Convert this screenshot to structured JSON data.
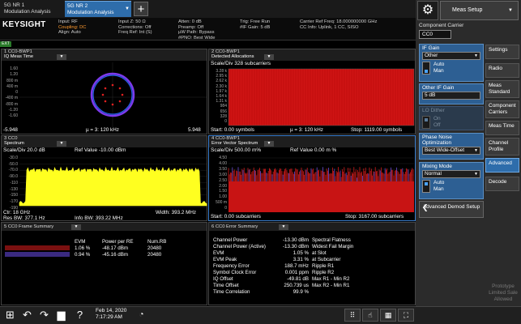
{
  "tabs": [
    {
      "line1": "5G NR 1",
      "line2": "Modulation Analysis",
      "active": false
    },
    {
      "line1": "5G NR 2",
      "line2": "Modulation Analysis",
      "active": true
    }
  ],
  "info": {
    "logo": "KEYSIGHT",
    "col1": [
      "Input: RF",
      "Coupling: DC",
      "Align: Auto"
    ],
    "col2": [
      "Input Z: 50 Ω",
      "Corrections: Off",
      "Freq Ref: Int (S)"
    ],
    "col3": [
      "Atten: 0 dB",
      "Preamp: Off",
      "µW Path: Bypass",
      "#PNO: Best Wide"
    ],
    "col4": [
      "Trig: Free Run",
      "#IF Gain: 5 dB"
    ],
    "col5": [
      "Carrier Ref Freq: 18.000000000 GHz",
      "CC Info: Uplink, 1 CC, SISO"
    ],
    "badge": "EXT"
  },
  "right": {
    "meas_setup": "Meas Setup",
    "component_carrier_label": "Component Carrier",
    "component_carrier_value": "CC0",
    "if_gain_title": "IF Gain",
    "if_gain_value": "Other",
    "if_gain_auto": "Auto",
    "if_gain_man": "Man",
    "other_if_gain_title": "Other IF Gain",
    "other_if_gain_value": "5 dB",
    "lo_dither_title": "LO Dither",
    "lo_dither_on": "On",
    "lo_dither_off": "Off",
    "phase_noise_title": "Phase Noise Optimization",
    "phase_noise_value": "Best Wide-Offset",
    "mixing_mode_title": "Mixing Mode",
    "mixing_mode_value": "Normal",
    "mixing_auto": "Auto",
    "mixing_man": "Man",
    "advanced_demod": "Advanced Demod Setup",
    "side_tabs": [
      "Settings",
      "Radio",
      "Meas Standard",
      "Component Carriers",
      "Meas Time",
      "Channel Profile",
      "Advanced",
      "Decode"
    ],
    "prototype": "Prototype Limited Sale Allowed"
  },
  "windows": {
    "w1": {
      "t1": "1 CC0-BWP1",
      "t2": "IQ Meas Time",
      "foot_left": "-5.948",
      "foot_mid": "µ = 3: 120 kHz",
      "foot_right": "5.948",
      "yticks": [
        "1.60",
        "1.20",
        "800 m",
        "400 m",
        "0",
        "-400 m",
        "-800 m",
        "-1.20",
        "-1.60"
      ]
    },
    "w2": {
      "t1": "2 CC0-BWP1",
      "t2": "Detected Allocations",
      "sub": "Scale/Div 328 subcarriers",
      "foot_left": "Start: 0.00 symbols",
      "foot_mid": "µ = 3: 120 kHz",
      "foot_right": "Stop: 1119.00 symbols",
      "yticks": [
        "3.28 k",
        "2.95 k",
        "2.62 k",
        "2.30 k",
        "1.97 k",
        "1.64 k",
        "1.31 k",
        "984",
        "656",
        "328",
        "0"
      ]
    },
    "w3": {
      "t1": "3 CC0",
      "t2": "Spectrum",
      "sub_left": "Scale/Div 20.0 dB",
      "sub_right": "Ref Value -10.00 dBm",
      "foot_left": "Ctr: 18 GHz",
      "foot_left2": "Res BW: 377.1 Hz",
      "foot_mid": "Info BW: 393.22 MHz",
      "foot_right": "Width: 393.2 MHz",
      "yticks": [
        "-30.0",
        "-50.0",
        "-70.0",
        "-90.0",
        "-110",
        "-130",
        "-150",
        "-170",
        "-190"
      ]
    },
    "w4": {
      "t1": "4 CC0-BWP1",
      "t2": "Error Vector Spectrum",
      "sub_left": "Scale/Div 500.00 m%",
      "sub_right": "Ref Value 0.00 m %",
      "foot_left": "Start: 0.00 subcarriers",
      "foot_right": "Stop: 3167.00 subcarriers",
      "yticks": [
        "4.50",
        "4.00",
        "3.50",
        "3.00",
        "2.50",
        "2.00",
        "1.50",
        "1.00",
        "500 m",
        "0"
      ]
    },
    "w5": {
      "t1": "5 CC0 Frame Summary",
      "headers": [
        "",
        "EVM",
        "Power per RE",
        "Num.RB"
      ],
      "rows": [
        [
          "",
          "1.06 %",
          "-48.17 dBm",
          "20480"
        ],
        [
          "",
          "0.94 %",
          "-45.16 dBm",
          "20480"
        ]
      ]
    },
    "w6": {
      "t1": "6 CC0 Error Summary",
      "rows": [
        [
          "Channel Power",
          "-13.30 dBm",
          "Spectral Flatness",
          ""
        ],
        [
          "Channel Power (Active)",
          "-13.30 dBm",
          "Widest Fail Margin",
          ""
        ],
        [
          "EVM",
          "1.05 %",
          "at Slot",
          ""
        ],
        [
          "EVM Peak",
          "3.31 %",
          "at Subcarrier",
          ""
        ],
        [
          "Frequency Error",
          "188.7 mHz",
          "Ripple R1",
          ""
        ],
        [
          "Symbol Clock Error",
          "0.001 ppm",
          "Ripple R2",
          ""
        ],
        [
          "IQ Offset",
          "-49.81 dB",
          "Max R1 - Min R2",
          ""
        ],
        [
          "Time Offset",
          "250.739 us",
          "Max R2 - Min R1",
          ""
        ],
        [
          "Time Correlation",
          "99.9 %",
          "",
          ""
        ]
      ]
    }
  },
  "taskbar": {
    "date": "Feb 14, 2020",
    "time": "7:17:29 AM"
  },
  "colors": {
    "accent": "#2e6dab",
    "trace_red": "#d81818",
    "trace_yellow": "#ffff20",
    "iq_ring": "#7c3aed"
  }
}
